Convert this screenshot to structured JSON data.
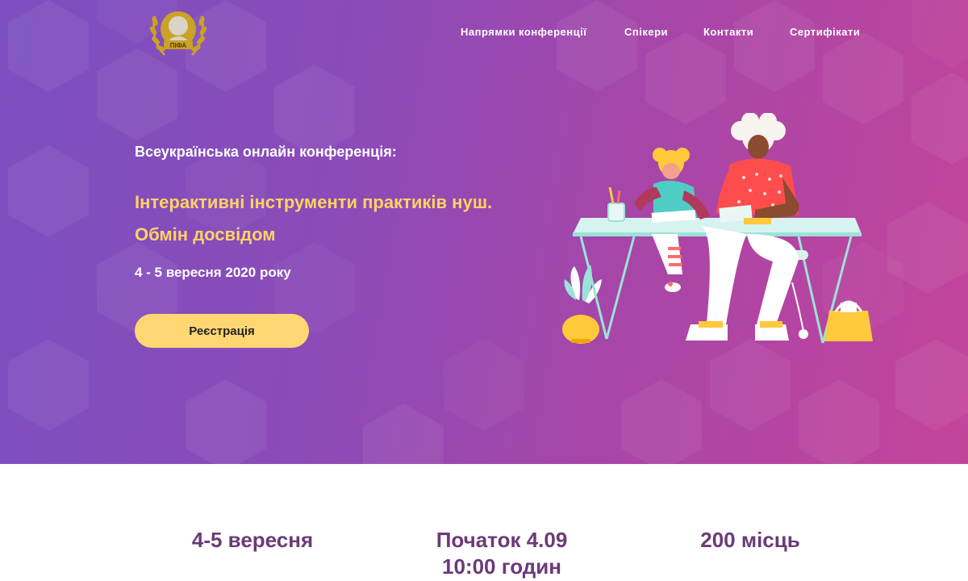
{
  "colors": {
    "hero_gradient_start": "#7c4fc0",
    "hero_gradient_end": "#c4449a",
    "accent_yellow": "#ffd166",
    "button_bg": "#ffd772",
    "stat_text": "#6b3a78"
  },
  "logo": {
    "icon": "laurel-bust-emblem",
    "text": "ПІФА"
  },
  "nav": {
    "items": [
      {
        "label": "Напрямки конференції"
      },
      {
        "label": "Спікери"
      },
      {
        "label": "Контакти"
      },
      {
        "label": "Сертифікати"
      }
    ]
  },
  "hero": {
    "subtitle": "Всеукраїнська онлайн конференція:",
    "title_line1": "Інтерактивні інструменти практиків нуш.",
    "title_line2": "Обмін досвідом",
    "date": "4 - 5 вересня 2020 року",
    "register_label": "Реєстрація",
    "illustration": "teacher-and-student-at-desk-illustration"
  },
  "stats": [
    {
      "line1": "4-5 вересня",
      "line2": ""
    },
    {
      "line1": "Початок 4.09",
      "line2": "10:00 годин"
    },
    {
      "line1": "200 місць",
      "line2": ""
    }
  ]
}
